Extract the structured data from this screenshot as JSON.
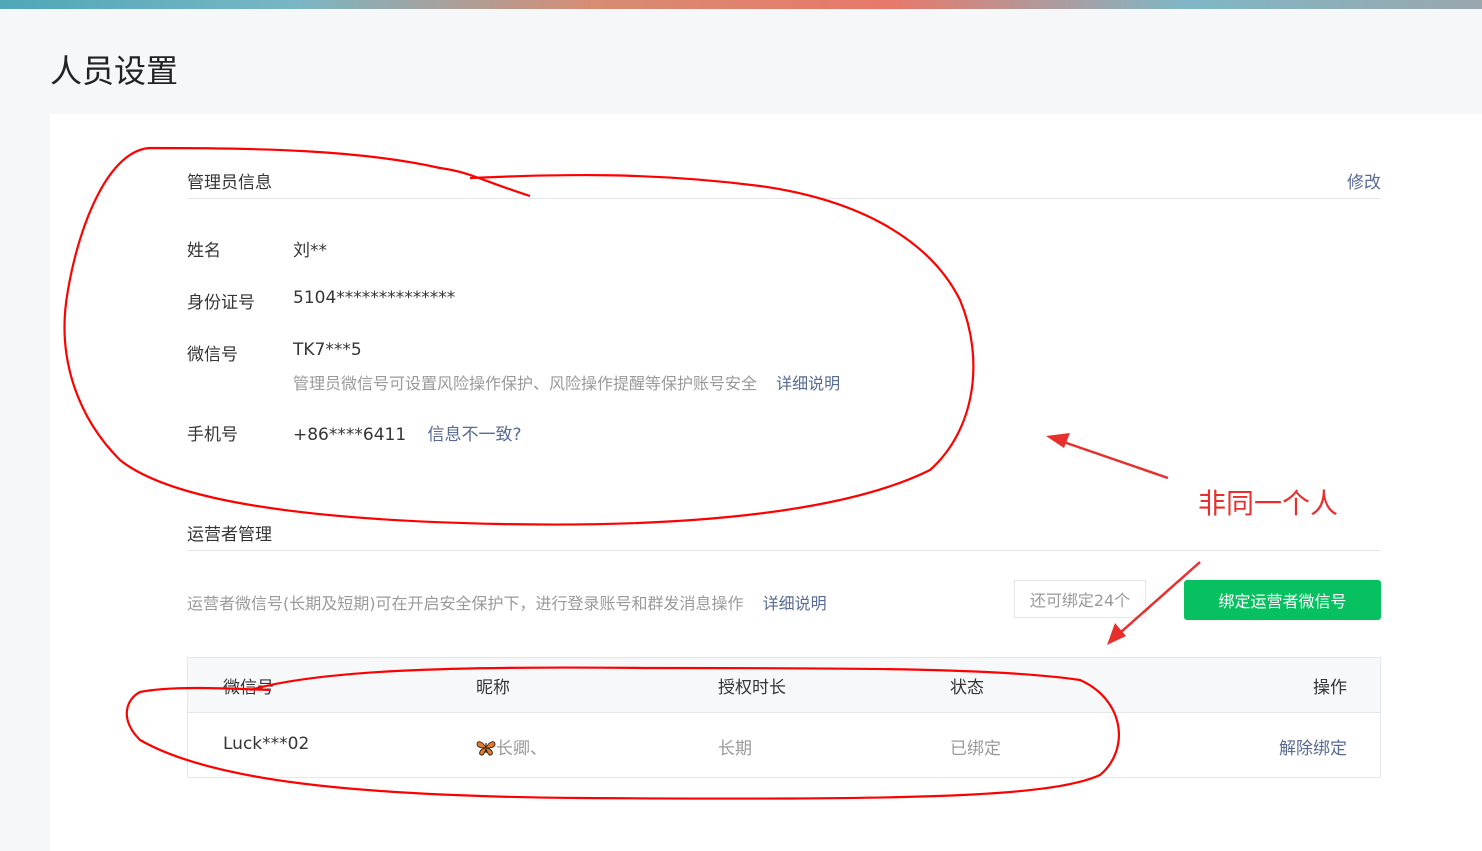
{
  "page": {
    "title": "人员设置"
  },
  "admin": {
    "section_title": "管理员信息",
    "edit_label": "修改",
    "name": {
      "label": "姓名",
      "value": "刘**"
    },
    "id_number": {
      "label": "身份证号",
      "value": "5104**************"
    },
    "wechat": {
      "label": "微信号",
      "value": "TK7***5",
      "tip": "管理员微信号可设置风险操作保护、风险操作提醒等保护账号安全",
      "tip_link": "详细说明"
    },
    "phone": {
      "label": "手机号",
      "value": "+86****6411",
      "link": "信息不一致?"
    }
  },
  "operators": {
    "section_title": "运营者管理",
    "description": "运营者微信号(长期及短期)可在开启安全保护下，进行登录账号和群发消息操作",
    "description_link": "详细说明",
    "quota": "还可绑定24个",
    "bind_button": "绑定运营者微信号",
    "columns": [
      "微信号",
      "昵称",
      "授权时长",
      "状态",
      "操作"
    ],
    "rows": [
      {
        "wechat_id": "Luck***02",
        "nickname_icon": "butterfly-icon",
        "nickname": "长卿、",
        "duration": "长期",
        "status": "已绑定",
        "action": "解除绑定"
      }
    ]
  },
  "annotation": {
    "text": "非同一个人",
    "color": "#e7302d"
  },
  "colors": {
    "accent_green": "#07c160",
    "link": "#576b95",
    "muted": "#9a9a9a"
  }
}
